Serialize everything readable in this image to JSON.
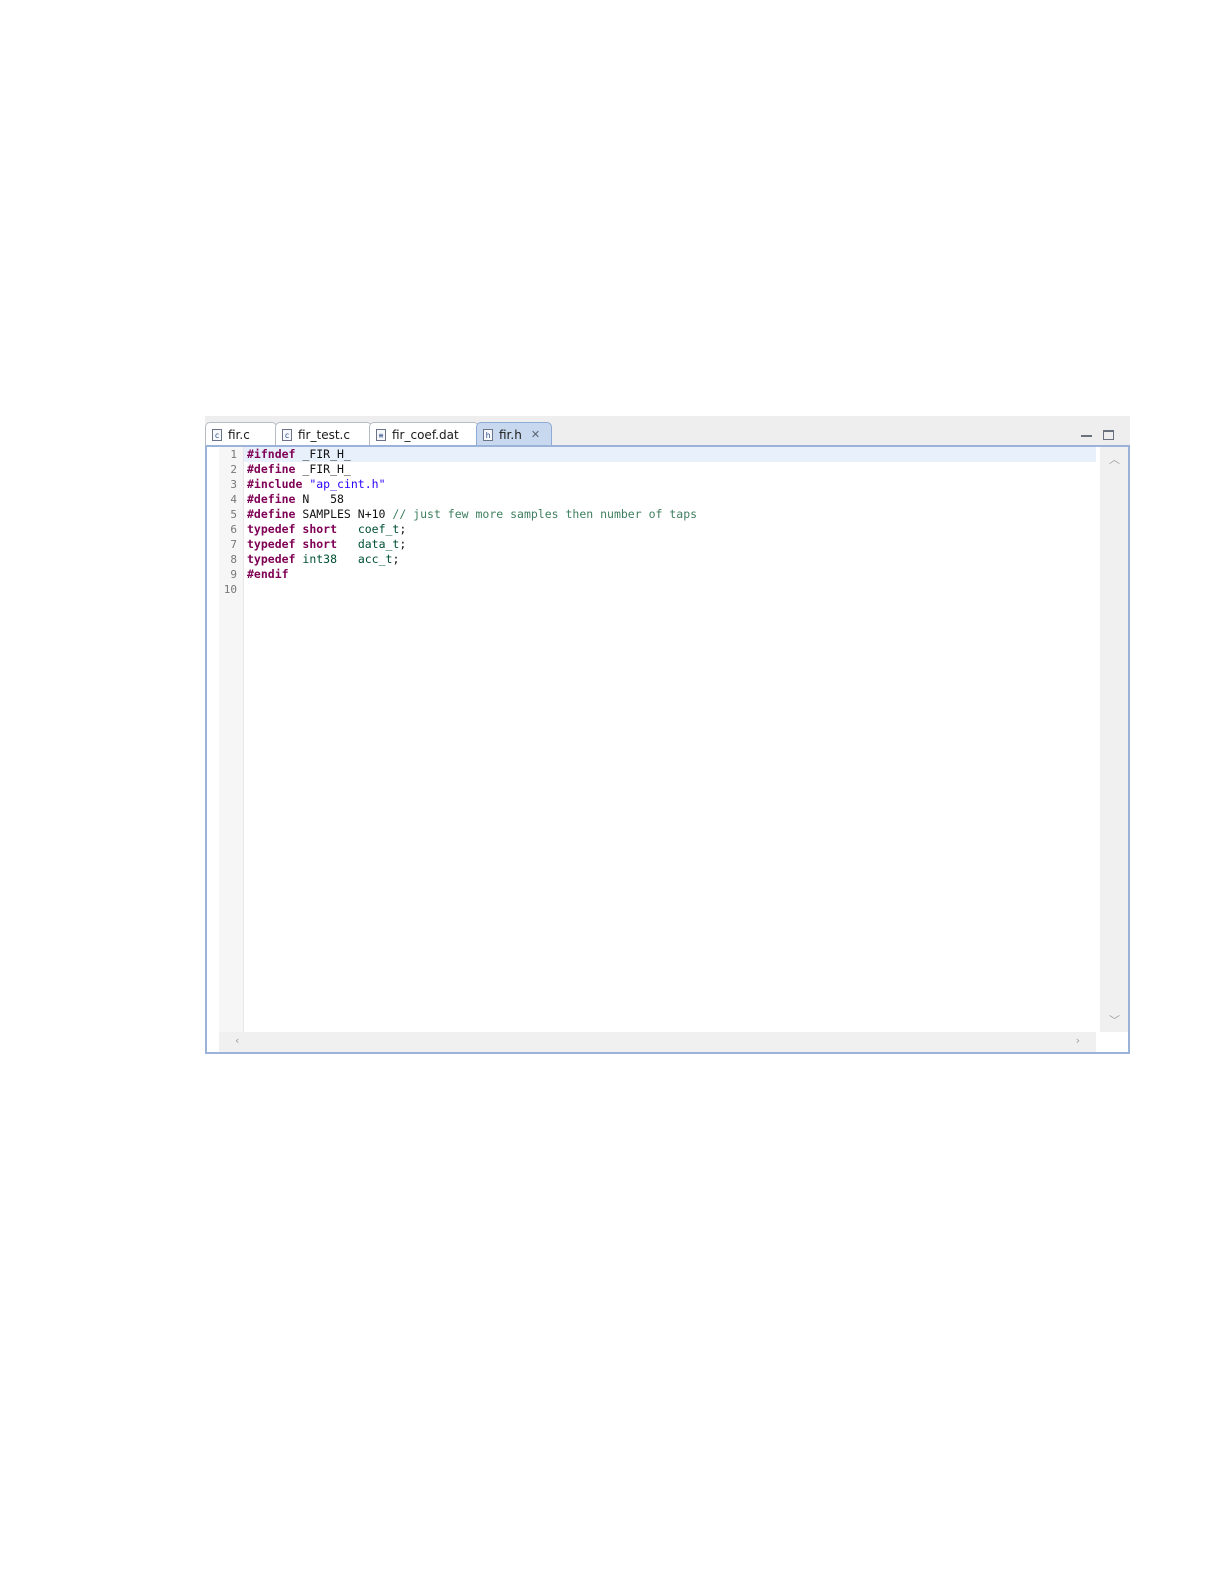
{
  "tabs": [
    {
      "label": "fir.c",
      "icon": "c-file-icon",
      "glyph": "c"
    },
    {
      "label": "fir_test.c",
      "icon": "c-file-icon",
      "glyph": "c"
    },
    {
      "label": "fir_coef.dat",
      "icon": "text-file-icon",
      "glyph": "≡"
    },
    {
      "label": "fir.h",
      "icon": "h-file-icon",
      "glyph": "h",
      "active": true
    }
  ],
  "editor": {
    "line_numbers": [
      "1",
      "2",
      "3",
      "4",
      "5",
      "6",
      "7",
      "8",
      "9",
      "10"
    ],
    "lines": [
      [
        {
          "t": "#ifndef",
          "c": "kw"
        },
        {
          "t": " _FIR_H_",
          "c": ""
        }
      ],
      [
        {
          "t": "#define",
          "c": "kw"
        },
        {
          "t": " _FIR_H_",
          "c": ""
        }
      ],
      [
        {
          "t": "#include",
          "c": "kw"
        },
        {
          "t": " ",
          "c": ""
        },
        {
          "t": "\"ap_cint.h\"",
          "c": "str"
        }
      ],
      [
        {
          "t": "#define",
          "c": "kw"
        },
        {
          "t": " N   58",
          "c": ""
        }
      ],
      [
        {
          "t": "#define",
          "c": "kw"
        },
        {
          "t": " SAMPLES N+10 ",
          "c": ""
        },
        {
          "t": "// just few more samples then number of taps",
          "c": "cmt"
        }
      ],
      [
        {
          "t": "typedef",
          "c": "kw"
        },
        {
          "t": " ",
          "c": ""
        },
        {
          "t": "short",
          "c": "kw"
        },
        {
          "t": "   ",
          "c": ""
        },
        {
          "t": "coef_t",
          "c": "id"
        },
        {
          "t": ";",
          "c": ""
        }
      ],
      [
        {
          "t": "typedef",
          "c": "kw"
        },
        {
          "t": " ",
          "c": ""
        },
        {
          "t": "short",
          "c": "kw"
        },
        {
          "t": "   ",
          "c": ""
        },
        {
          "t": "data_t",
          "c": "id"
        },
        {
          "t": ";",
          "c": ""
        }
      ],
      [
        {
          "t": "typedef",
          "c": "kw"
        },
        {
          "t": " ",
          "c": ""
        },
        {
          "t": "int38",
          "c": "id"
        },
        {
          "t": "   ",
          "c": ""
        },
        {
          "t": "acc_t",
          "c": "id"
        },
        {
          "t": ";",
          "c": ""
        }
      ],
      [
        {
          "t": "#endif",
          "c": "kw"
        }
      ],
      []
    ]
  },
  "colors": {
    "keyword": "#7f0055",
    "string": "#2a00ff",
    "comment": "#3f7f5f",
    "identifier": "#005032",
    "active_tab": "#c8d9ef"
  }
}
